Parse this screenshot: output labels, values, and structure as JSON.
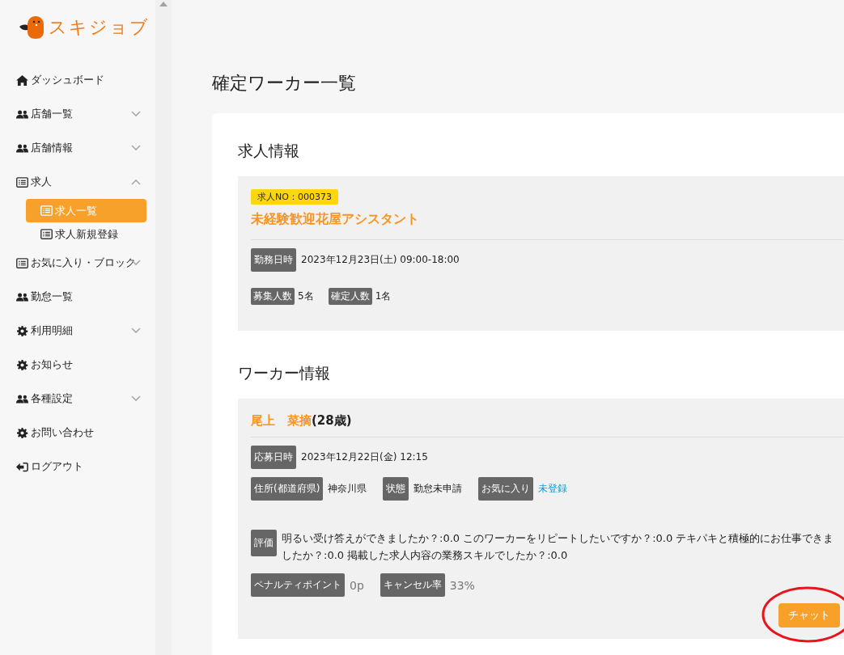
{
  "logo": {
    "text": "スキジョブ"
  },
  "sidebar": {
    "items": [
      {
        "label": "ダッシュボード",
        "kind": "home",
        "selected": false
      },
      {
        "label": "店舗一覧",
        "kind": "users",
        "selected": false,
        "expanded": false
      },
      {
        "label": "店舗情報",
        "kind": "users",
        "selected": false,
        "expanded": false
      },
      {
        "label": "求人",
        "kind": "list",
        "selected": false,
        "expanded": true,
        "children": [
          {
            "label": "求人一覧",
            "kind": "list",
            "selected": true
          },
          {
            "label": "求人新規登録",
            "kind": "list",
            "selected": false
          }
        ]
      },
      {
        "label": "お気に入り・ブロック",
        "kind": "list",
        "selected": false,
        "expanded": false
      },
      {
        "label": "勤怠一覧",
        "kind": "users",
        "selected": false
      },
      {
        "label": "利用明細",
        "kind": "gear",
        "selected": false,
        "expanded": false
      },
      {
        "label": "お知らせ",
        "kind": "gear",
        "selected": false
      },
      {
        "label": "各種設定",
        "kind": "users",
        "selected": false,
        "expanded": false
      },
      {
        "label": "お問い合わせ",
        "kind": "gear",
        "selected": false
      },
      {
        "label": "ログアウト",
        "kind": "logout",
        "selected": false
      }
    ]
  },
  "page_title": "確定ワーカー一覧",
  "job": {
    "heading": "求人情報",
    "job_no": "求人NO：000373",
    "title": "未経験歓迎花屋アシスタント",
    "work_datetime": {
      "label": "勤務日時",
      "value": "2023年12月23日(土) 09:00-18:00"
    },
    "counts": [
      {
        "label": "募集人数",
        "value": "5名"
      },
      {
        "label": "確定人数",
        "value": "1名"
      }
    ]
  },
  "worker": {
    "heading": "ワーカー情報",
    "name": "尾上　菜摘",
    "age": "(28歳)",
    "applied": {
      "label": "応募日時",
      "value": "2023年12月22日(金) 12:15"
    },
    "attributes": [
      {
        "label": "住所(都道府県)",
        "value": "神奈川県",
        "kind": "text"
      },
      {
        "label": "状態",
        "value": "勤怠未申請",
        "kind": "text"
      },
      {
        "label": "お気に入り",
        "value": "未登録",
        "kind": "link"
      }
    ],
    "rating": {
      "label": "評価",
      "text": "明るい受け答えができましたか？:0.0  このワーカーをリピートしたいですか？:0.0  テキパキと積極的にお仕事できましたか？:0.0  掲載した求人内容の業務スキルでしたか？:0.0"
    },
    "stats": [
      {
        "label": "ペナルティポイント",
        "value": "0p"
      },
      {
        "label": "キャンセル率",
        "value": "33%"
      }
    ],
    "chat_button": "チャット"
  }
}
